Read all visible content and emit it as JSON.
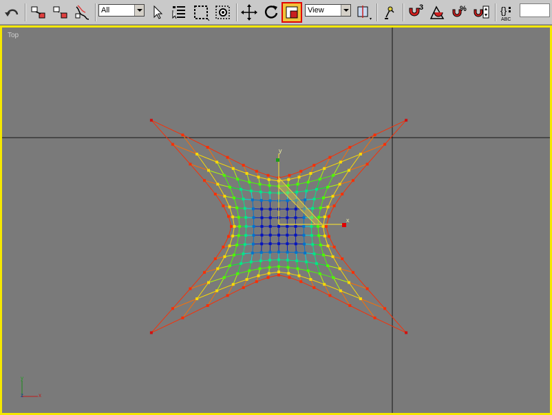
{
  "toolbar": {
    "selection_filter": "All",
    "reference_coord": "View",
    "named_selection": ""
  },
  "viewport": {
    "label": "Top",
    "frame_color": "#f5e800",
    "background": "#7a7a7a",
    "gizmo_axis_x": "x",
    "gizmo_axis_y": "y",
    "axis_tripod": {
      "x": "x",
      "y": "y",
      "z": "z"
    }
  },
  "colors": {
    "active_tool_outline": "#e00000",
    "active_tool_fill": "#f0c23a",
    "gizmo_color": "#e8d43a",
    "pivot_color": "#e00000"
  },
  "icons": [
    "undo-icon",
    "select-and-link-icon",
    "unlink-icon",
    "bind-to-space-warp-icon",
    "select-object-icon",
    "select-by-name-icon",
    "rectangular-selection-icon",
    "window-crossing-icon",
    "move-icon",
    "rotate-icon",
    "scale-icon",
    "use-pivot-center-icon",
    "manipulate-icon",
    "snap-3d-icon",
    "angle-snap-icon",
    "percent-snap-icon",
    "spinner-snap-icon",
    "edit-named-selection-icon"
  ]
}
